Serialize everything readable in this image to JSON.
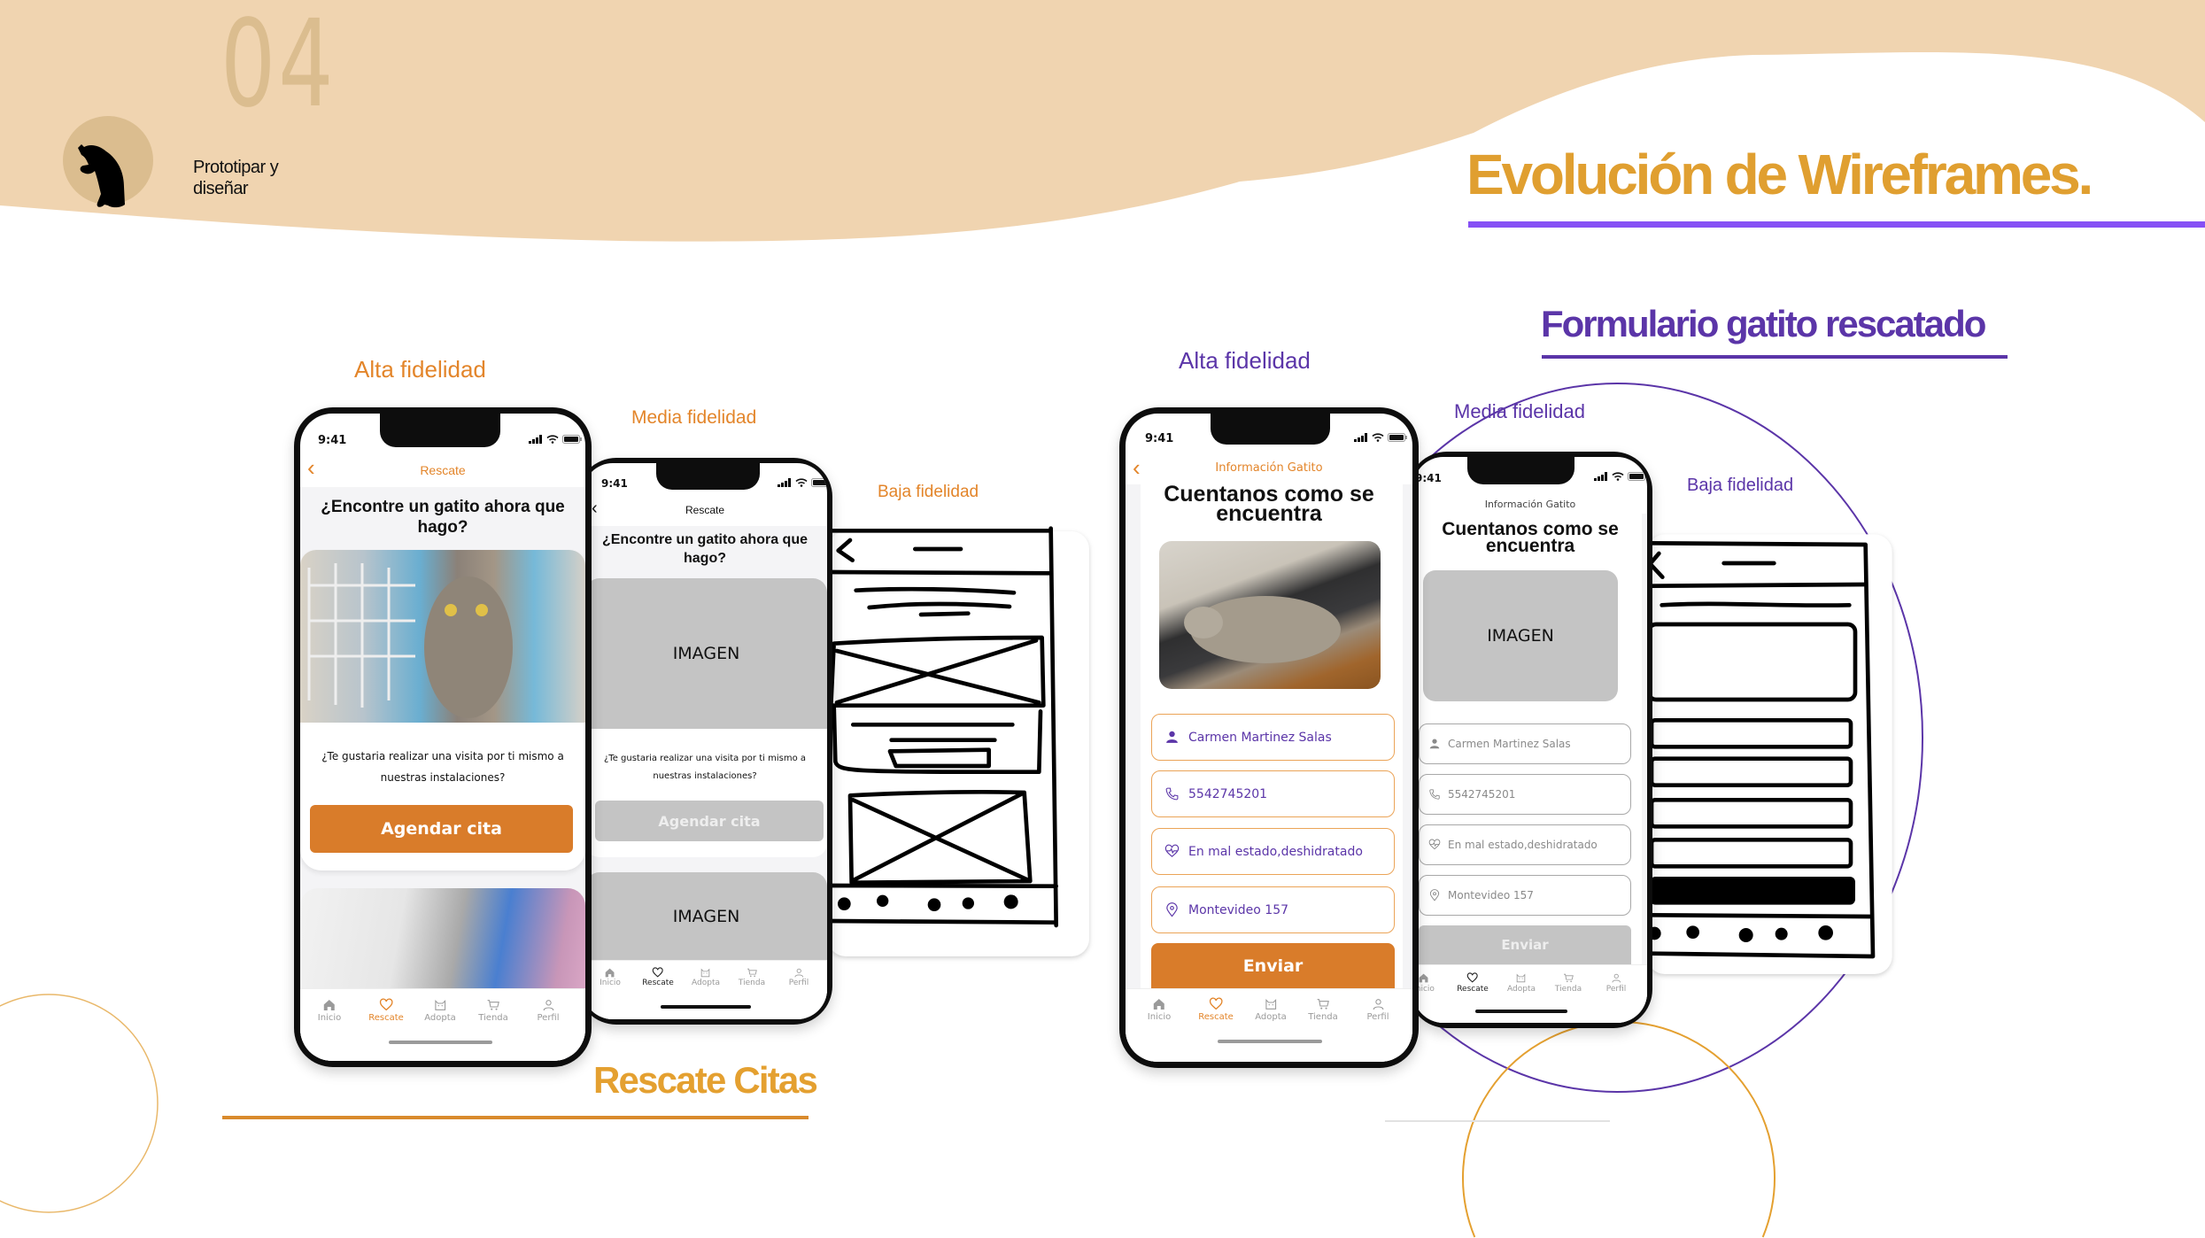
{
  "header": {
    "section_number": "04",
    "section_label": "Prototipar y diseñar",
    "title": "Evolución de Wireframes."
  },
  "colors": {
    "beige": "#f0d4b0",
    "tan": "#dbbd8f",
    "orange": "#e3852a",
    "button_orange": "#d97c2a",
    "title_orange": "#e09f30",
    "purple": "#5b35a8",
    "violet": "#8650f5",
    "placeholder_gray": "#c4c4c4"
  },
  "rescate_group": {
    "title": "Rescate Citas",
    "label_high": "Alta fidelidad",
    "label_mid": "Media fidelidad",
    "label_low": "Baja fidelidad",
    "high_phone": {
      "time": "9:41",
      "screen_title": "Rescate",
      "question": "¿Encontre un gatito ahora que hago?",
      "prompt": "¿Te  gustaria realizar una visita por ti mismo a nuestras instalaciones?",
      "button": "Agendar cita"
    },
    "mid_phone": {
      "time": "9:41",
      "screen_title": "Rescate",
      "question": "¿Encontre un gatito ahora que hago?",
      "image_placeholder": "IMAGEN",
      "prompt": "¿Te  gustaria realizar una visita por ti mismo a nuestras instalaciones?",
      "button": "Agendar cita",
      "image_placeholder_2": "IMAGEN"
    }
  },
  "form_group": {
    "title": "Formulario gatito rescatado",
    "label_high": "Alta fidelidad",
    "label_mid": "Media fidelidad",
    "label_low": "Baja fidelidad",
    "high_phone": {
      "time": "9:41",
      "screen_title": "Información Gatito",
      "heading": "Cuentanos como se encuentra",
      "fields": [
        {
          "icon": "person-icon",
          "value": "Carmen Martinez Salas"
        },
        {
          "icon": "phone-icon",
          "value": "5542745201"
        },
        {
          "icon": "heart-pulse-icon",
          "value": "En mal estado,deshidratado"
        },
        {
          "icon": "location-icon",
          "value": "Montevideo 157"
        }
      ],
      "button": "Enviar"
    },
    "mid_phone": {
      "time": "9:41",
      "screen_title": "Información Gatito",
      "heading": "Cuentanos como se encuentra",
      "image_placeholder": "IMAGEN",
      "fields": [
        {
          "icon": "person-icon",
          "value": "Carmen Martinez Salas"
        },
        {
          "icon": "phone-icon",
          "value": "5542745201"
        },
        {
          "icon": "heart-pulse-icon",
          "value": "En mal estado,deshidratado"
        },
        {
          "icon": "location-icon",
          "value": "Montevideo 157"
        }
      ],
      "button": "Enviar"
    }
  },
  "tabs": [
    {
      "label": "Inicio",
      "icon": "home-icon"
    },
    {
      "label": "Rescate",
      "icon": "heart-icon"
    },
    {
      "label": "Adopta",
      "icon": "cat-icon"
    },
    {
      "label": "Tienda",
      "icon": "cart-icon"
    },
    {
      "label": "Perfil",
      "icon": "person-icon"
    }
  ],
  "active_tab": "Rescate"
}
